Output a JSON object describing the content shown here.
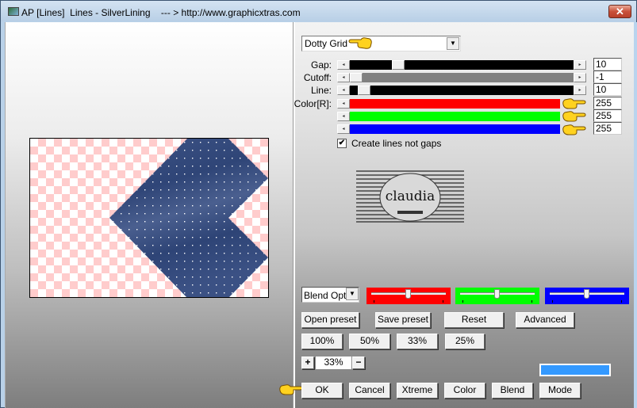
{
  "window": {
    "title": "AP [Lines]  Lines - SilverLining    --- > http://www.graphicxtras.com",
    "close_label": "✕"
  },
  "preset": {
    "selected": "Dotty Grid"
  },
  "sliders": [
    {
      "name": "gap",
      "label": "Gap:",
      "value": "10",
      "fraction": 0.1,
      "track_color": "#000000"
    },
    {
      "name": "cutoff",
      "label": "Cutoff:",
      "value": "-1",
      "fraction": 0.0,
      "track_color": "#808080"
    },
    {
      "name": "line",
      "label": "Line:",
      "value": "10",
      "fraction": 0.02,
      "track_color": "#000000"
    }
  ],
  "color": {
    "label": "Color[R]:",
    "channels": [
      {
        "name": "red",
        "value": "255",
        "fraction": 1.0,
        "track_color": "#ff0000"
      },
      {
        "name": "green",
        "value": "255",
        "fraction": 1.0,
        "track_color": "#00ff00"
      },
      {
        "name": "blue",
        "value": "255",
        "fraction": 1.0,
        "track_color": "#0000ff"
      }
    ]
  },
  "checkbox": {
    "label": "Create lines not gaps",
    "checked": true,
    "check_glyph": "✔"
  },
  "logo": {
    "text": "claudia"
  },
  "blend": {
    "select_value": "Blend Options",
    "color_sliders": [
      {
        "name": "red",
        "color": "#ff0000",
        "fraction": 0.5
      },
      {
        "name": "green",
        "color": "#00ff00",
        "fraction": 0.5
      },
      {
        "name": "blue",
        "color": "#0000ff",
        "fraction": 0.5
      }
    ]
  },
  "buttons": {
    "open_preset": "Open preset",
    "save_preset": "Save preset",
    "reset": "Reset",
    "advanced": "Advanced",
    "zoom_100": "100%",
    "zoom_50": "50%",
    "zoom_33": "33%",
    "zoom_25": "25%",
    "zoom_plus": "+",
    "zoom_minus": "−",
    "ok": "OK",
    "cancel": "Cancel",
    "xtreme": "Xtreme",
    "color": "Color",
    "blend": "Blend",
    "mode": "Mode"
  },
  "zoom": {
    "value": "33%"
  },
  "swatch": {
    "color": "#3399ff"
  },
  "arrows": {
    "left": "◂",
    "right": "▸",
    "down": "▼"
  }
}
